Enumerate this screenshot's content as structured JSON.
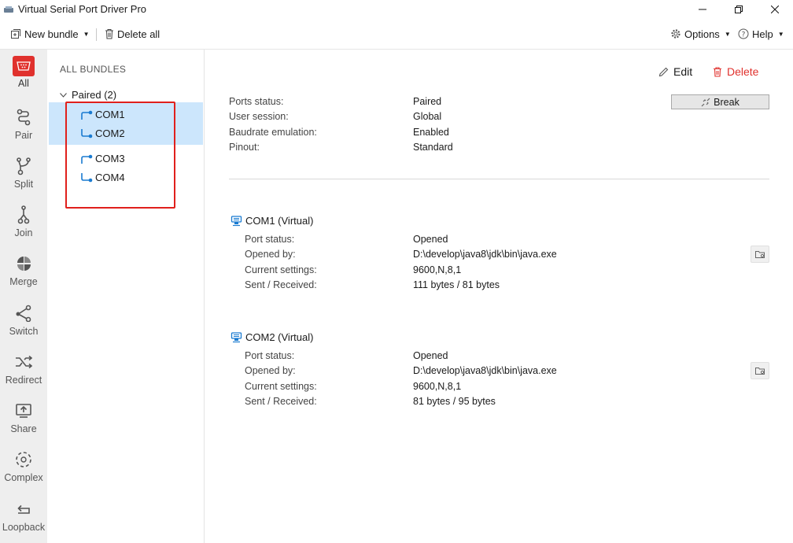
{
  "window": {
    "title": "Virtual Serial Port Driver Pro"
  },
  "toolbar": {
    "new_bundle": "New bundle",
    "delete_all": "Delete all",
    "options": "Options",
    "help": "Help"
  },
  "nav": {
    "items": [
      {
        "label": "All",
        "icon": "all-icon"
      },
      {
        "label": "Pair",
        "icon": "pair-icon"
      },
      {
        "label": "Split",
        "icon": "split-icon"
      },
      {
        "label": "Join",
        "icon": "join-icon"
      },
      {
        "label": "Merge",
        "icon": "merge-icon"
      },
      {
        "label": "Switch",
        "icon": "switch-icon"
      },
      {
        "label": "Redirect",
        "icon": "redirect-icon"
      },
      {
        "label": "Share",
        "icon": "share-icon"
      },
      {
        "label": "Complex",
        "icon": "complex-icon"
      },
      {
        "label": "Loopback",
        "icon": "loopback-icon"
      }
    ]
  },
  "bundles": {
    "title": "ALL BUNDLES",
    "group": "Paired (2)",
    "items": [
      {
        "ports": [
          "COM1",
          "COM2"
        ],
        "selected": true
      },
      {
        "ports": [
          "COM3",
          "COM4"
        ],
        "selected": false
      }
    ]
  },
  "main": {
    "edit": "Edit",
    "delete": "Delete",
    "break": "Break",
    "summary": [
      {
        "label": "Ports status:",
        "value": "Paired"
      },
      {
        "label": "User session:",
        "value": "Global"
      },
      {
        "label": "Baudrate emulation:",
        "value": "Enabled"
      },
      {
        "label": "Pinout:",
        "value": "Standard"
      }
    ],
    "ports": [
      {
        "title": "COM1 (Virtual)",
        "rows": [
          {
            "label": "Port status:",
            "value": "Opened"
          },
          {
            "label": "Opened by:",
            "value": "D:\\develop\\java8\\jdk\\bin\\java.exe"
          },
          {
            "label": "Current settings:",
            "value": "9600,N,8,1"
          },
          {
            "label": "Sent / Received:",
            "value": "111 bytes / 81 bytes"
          }
        ]
      },
      {
        "title": "COM2 (Virtual)",
        "rows": [
          {
            "label": "Port status:",
            "value": "Opened"
          },
          {
            "label": "Opened by:",
            "value": "D:\\develop\\java8\\jdk\\bin\\java.exe"
          },
          {
            "label": "Current settings:",
            "value": "9600,N,8,1"
          },
          {
            "label": "Sent / Received:",
            "value": "81 bytes / 95 bytes"
          }
        ]
      }
    ]
  },
  "colors": {
    "accent_red": "#e0312d",
    "selection_blue": "#cce6fc",
    "port_icon_blue": "#1a7bd1"
  }
}
